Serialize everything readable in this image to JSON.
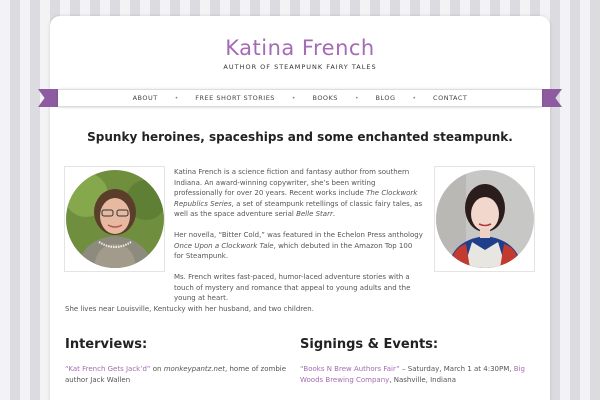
{
  "header": {
    "site_title": "Katina French",
    "tagline": "AUTHOR OF STEAMPUNK FAIRY TALES"
  },
  "nav": {
    "items": [
      {
        "label": "ABOUT"
      },
      {
        "label": "FREE SHORT STORIES"
      },
      {
        "label": "BOOKS"
      },
      {
        "label": "BLOG"
      },
      {
        "label": "CONTACT"
      }
    ],
    "separator": "•"
  },
  "main": {
    "headline": "Spunky heroines, spaceships and some enchanted steampunk.",
    "bio": {
      "p1_a": "Katina French is a science fiction and fantasy author from southern Indiana. An award-winning copywriter, she’s been writing professionally for over 20 years. Recent works include ",
      "p1_b": "The Clockwork Republics Series",
      "p1_c": ", a set of steampunk retellings of classic fairy tales, as well as the space adventure serial ",
      "p1_d": "Belle Starr",
      "p1_e": ".",
      "p2_a": "Her novella, “Bitter Cold,” was featured in the Echelon Press anthology ",
      "p2_b": "Once Upon a Clockwork Tale",
      "p2_c": ", which debuted in the Amazon Top 100 for Steampunk.",
      "p3": "Ms. French writes fast-paced, humor-laced adventure stories with a touch of mystery and romance that appeal to young adults and the young at heart.",
      "p4": "She lives near Louisville, Kentucky with her husband, and two children."
    },
    "interviews": {
      "heading": "Interviews:",
      "item1_link": "“Kat French Gets Jack’d”",
      "item1_on": " on ",
      "item1_site": "monkeypantz.net",
      "item1_rest": ", home of zombie author Jack Wallen"
    },
    "events": {
      "heading": "Signings & Events:",
      "item1_link": "“Books N Brew Authors Fair”",
      "item1_text": " – Saturday, March 1 at 4:30PM, ",
      "item1_link2": "Big Woods Brewing Company",
      "item1_text2": ", Nashville, Indiana"
    }
  },
  "colors": {
    "accent": "#a66bb5",
    "ribbon": "#8e5aa0"
  }
}
